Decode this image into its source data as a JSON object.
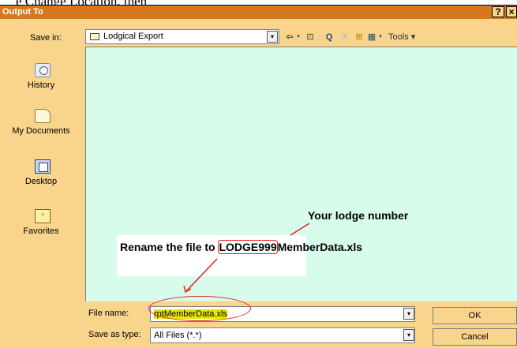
{
  "caption_top": "e Change Location, then",
  "window": {
    "title": "Output To",
    "help_label": "?",
    "close_label": "×"
  },
  "toolbar": {
    "save_in_label": "Save in:",
    "save_in_value": "Lodgical Export",
    "dropdown_glyph": "▾",
    "back_glyph": "⇦",
    "up_glyph": "⊡",
    "search_glyph": "Q",
    "delete_glyph": "✕",
    "newfolder_glyph": "⊞",
    "views_glyph": "▦",
    "tools_label": "Tools ▾"
  },
  "places": [
    {
      "label": "History",
      "icon": "history-icon"
    },
    {
      "label": "My Documents",
      "icon": "my-documents-icon"
    },
    {
      "label": "Desktop",
      "icon": "desktop-icon"
    },
    {
      "label": "Favorites",
      "icon": "favorites-icon"
    }
  ],
  "annotation": {
    "lodge_number": "Your lodge number",
    "rename_prefix": "Rename the file to ",
    "rename_highlight": "LODGE999",
    "rename_suffix": "MemberData.xls"
  },
  "bottom": {
    "file_name_label": "File name:",
    "file_name_value": "rptMemberData.xls",
    "save_type_label": "Save as type:",
    "save_type_value": "All Files (*.*)",
    "ok_label": "OK",
    "cancel_label": "Cancel"
  },
  "colors": {
    "titlebar": "#d8781c",
    "dialog_bg": "#f8d48c",
    "file_list_bg": "#d8fcec",
    "annotation_red": "#e02020"
  }
}
